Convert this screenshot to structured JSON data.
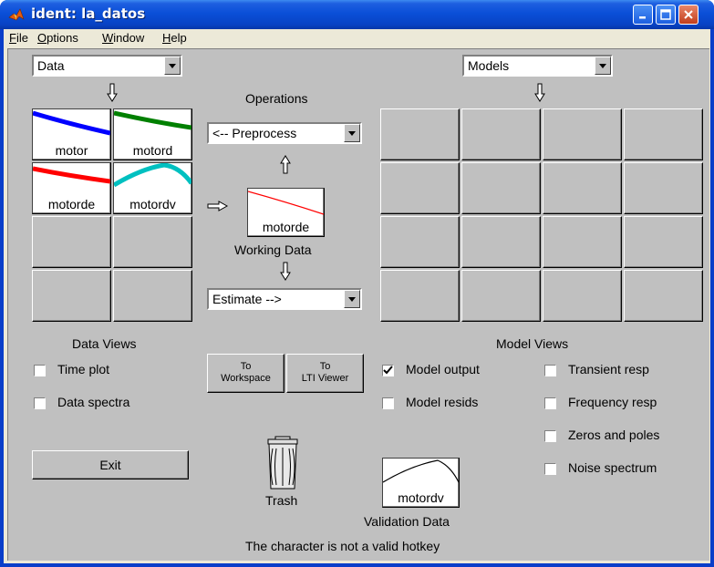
{
  "window": {
    "title": "ident: la_datos"
  },
  "menu": [
    {
      "label": "File",
      "key": "F",
      "rest": "ile"
    },
    {
      "label": "Options",
      "key": "O",
      "rest": "ptions"
    },
    {
      "label": "Window",
      "key": "W",
      "rest": "indow"
    },
    {
      "label": "Help",
      "key": "H",
      "rest": "elp"
    }
  ],
  "data_select": {
    "value": "Data"
  },
  "models_select": {
    "value": "Models"
  },
  "operations_label": "Operations",
  "preprocess_select": {
    "value": "<-- Preprocess"
  },
  "estimate_select": {
    "value": "Estimate -->"
  },
  "working_data": {
    "name": "motorde",
    "caption": "Working Data"
  },
  "data_slots": [
    "motor",
    "motord",
    "motorde",
    "motordv"
  ],
  "data_views": {
    "title": "Data Views",
    "time_plot": {
      "label": "Time plot",
      "checked": false
    },
    "data_spectra": {
      "label": "Data spectra",
      "checked": false
    }
  },
  "to_workspace": {
    "line1": "To",
    "line2": "Workspace"
  },
  "to_lti": {
    "line1": "To",
    "line2": "LTI Viewer"
  },
  "model_views": {
    "title": "Model Views",
    "model_output": {
      "label": "Model output",
      "checked": true
    },
    "model_resids": {
      "label": "Model resids",
      "checked": false
    },
    "transient_resp": {
      "label": "Transient resp",
      "checked": false
    },
    "frequency_resp": {
      "label": "Frequency resp",
      "checked": false
    },
    "zeros_poles": {
      "label": "Zeros and poles",
      "checked": false
    },
    "noise_spectrum": {
      "label": "Noise spectrum",
      "checked": false
    }
  },
  "exit_label": "Exit",
  "trash_label": "Trash",
  "validation_data": {
    "name": "motordv",
    "caption": "Validation Data"
  },
  "status": "The character  is not a valid hotkey",
  "colors": {
    "motor": "#0000ff",
    "motord": "#008000",
    "motorde": "#ff0000",
    "motordv": "#00c0c0",
    "title_bar": "#0a4fd8"
  }
}
